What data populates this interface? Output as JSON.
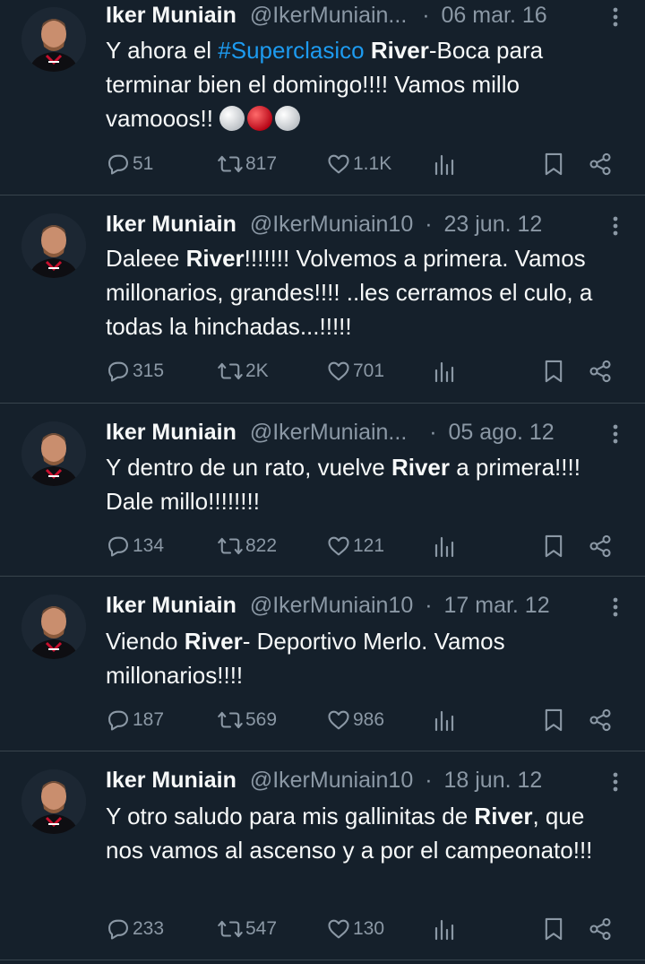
{
  "colors": {
    "background": "#15202b",
    "text": "#f7f9f9",
    "muted": "#8b98a5",
    "link": "#1d9bf0",
    "divider": "#38444d"
  },
  "tweets": [
    {
      "name": "Iker Muniain",
      "handle": "@IkerMuniain...",
      "separator": "·",
      "date": "06 mar. 16",
      "text_parts": [
        "Y ahora el ",
        "#Superclasico",
        " ",
        "River",
        "-Boca para terminar bien el domingo!!!! Vamos millo vamooos!!"
      ],
      "emoji": "white-red-white-balls",
      "replies": "51",
      "reposts": "817",
      "likes": "1.1K"
    },
    {
      "name": "Iker Muniain",
      "handle": "@IkerMuniain10",
      "separator": "·",
      "date": "23 jun. 12",
      "text_parts": [
        "Daleee ",
        "River",
        "!!!!!!! Volvemos a primera. Vamos millonarios, grandes!!!! ..les cerramos el culo, a todas la hinchadas...!!!!!"
      ],
      "replies": "315",
      "reposts": "2K",
      "likes": "701"
    },
    {
      "name": "Iker Muniain",
      "handle": "@IkerMuniain...",
      "separator": "·",
      "date": "05 ago. 12",
      "text_parts": [
        "Y dentro de un rato, vuelve ",
        "River",
        " a primera!!!! Dale millo!!!!!!!!"
      ],
      "replies": "134",
      "reposts": "822",
      "likes": "121"
    },
    {
      "name": "Iker Muniain",
      "handle": "@IkerMuniain10",
      "separator": "·",
      "date": "17 mar. 12",
      "text_parts": [
        "Viendo ",
        "River",
        "- Deportivo Merlo. Vamos millonarios!!!!"
      ],
      "replies": "187",
      "reposts": "569",
      "likes": "986"
    },
    {
      "name": "Iker Muniain",
      "handle": "@IkerMuniain10",
      "separator": "·",
      "date": "18 jun. 12",
      "text_parts": [
        "Y otro saludo para mis gallinitas de ",
        "River",
        ", que nos vamos al ascenso y a por el campeonato!!!"
      ],
      "replies": "233",
      "reposts": "547",
      "likes": "130"
    }
  ],
  "icons": [
    "more-icon",
    "reply-icon",
    "repost-icon",
    "like-icon",
    "views-icon",
    "bookmark-icon",
    "share-icon"
  ]
}
